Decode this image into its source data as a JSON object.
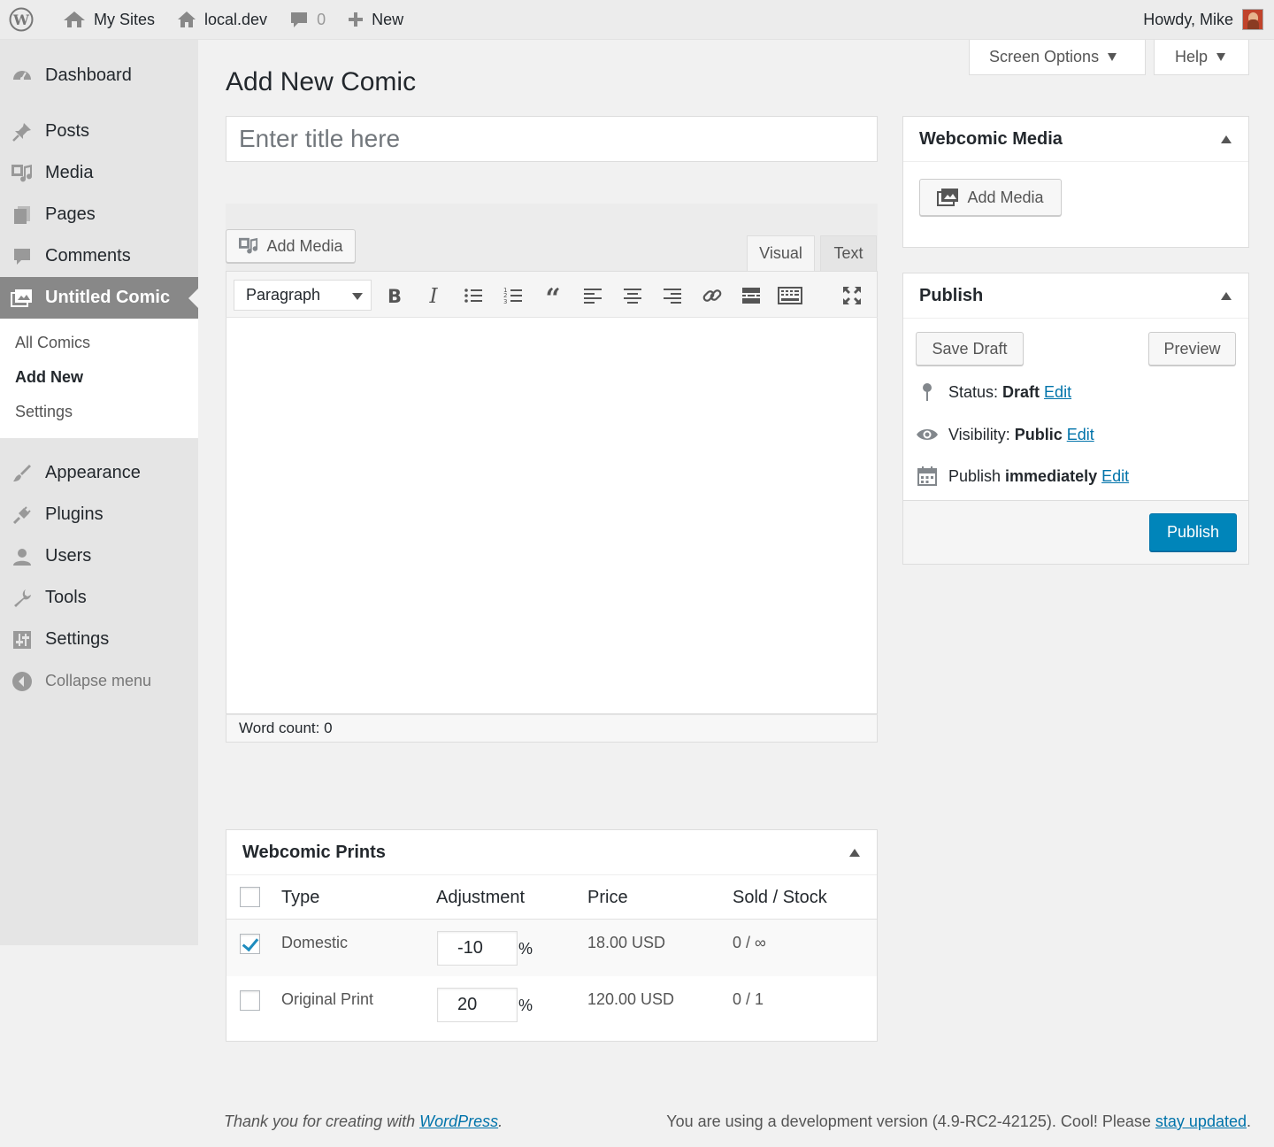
{
  "adminbar": {
    "my_sites": "My Sites",
    "site_name": "local.dev",
    "comments_count": "0",
    "new_label": "New",
    "howdy": "Howdy, Mike"
  },
  "sidebar": {
    "items": [
      {
        "label": "Dashboard",
        "icon": "dashboard-icon"
      },
      {
        "label": "Posts",
        "icon": "pin-icon"
      },
      {
        "label": "Media",
        "icon": "media-icon"
      },
      {
        "label": "Pages",
        "icon": "pages-icon"
      },
      {
        "label": "Comments",
        "icon": "comment-icon"
      },
      {
        "label": "Untitled Comic",
        "icon": "images-icon"
      }
    ],
    "submenu": [
      "All Comics",
      "Add New",
      "Settings"
    ],
    "items_lower": [
      {
        "label": "Appearance",
        "icon": "brush-icon"
      },
      {
        "label": "Plugins",
        "icon": "plug-icon"
      },
      {
        "label": "Users",
        "icon": "user-icon"
      },
      {
        "label": "Tools",
        "icon": "wrench-icon"
      },
      {
        "label": "Settings",
        "icon": "sliders-icon"
      }
    ],
    "collapse": "Collapse menu"
  },
  "screen_meta": {
    "screen_options": "Screen Options",
    "help": "Help"
  },
  "page": {
    "title": "Add New Comic",
    "title_placeholder": "Enter title here"
  },
  "editor": {
    "add_media": "Add Media",
    "tab_visual": "Visual",
    "tab_text": "Text",
    "format": "Paragraph",
    "word_count_label": "Word count:",
    "word_count": "0"
  },
  "webcomic_media": {
    "title": "Webcomic Media",
    "add_media": "Add Media"
  },
  "publish": {
    "title": "Publish",
    "save_draft": "Save Draft",
    "preview": "Preview",
    "status_label": "Status:",
    "status_value": "Draft",
    "visibility_label": "Visibility:",
    "visibility_value": "Public",
    "publish_label": "Publish",
    "publish_value": "immediately",
    "edit": "Edit",
    "publish_button": "Publish"
  },
  "prints": {
    "title": "Webcomic Prints",
    "headers": {
      "type": "Type",
      "adjustment": "Adjustment",
      "price": "Price",
      "sold_stock": "Sold / Stock"
    },
    "rows": [
      {
        "type": "Domestic",
        "adjustment": "-10",
        "pct": "%",
        "price": "18.00 USD",
        "sold_stock": "0 / ∞",
        "checked": true
      },
      {
        "type": "Original Print",
        "adjustment": "20",
        "pct": "%",
        "price": "120.00 USD",
        "sold_stock": "0 / 1",
        "checked": false
      }
    ]
  },
  "footer": {
    "thanks_prefix": "Thank you for creating with",
    "wordpress": "WordPress",
    "thanks_suffix": ".",
    "version_text": "You are using a development version (4.9-RC2-42125). Cool! Please",
    "stay_updated": "stay updated",
    "version_suffix": "."
  },
  "colors": {
    "accent": "#0085ba",
    "link": "#0073aa",
    "current_menu": "#888888"
  }
}
